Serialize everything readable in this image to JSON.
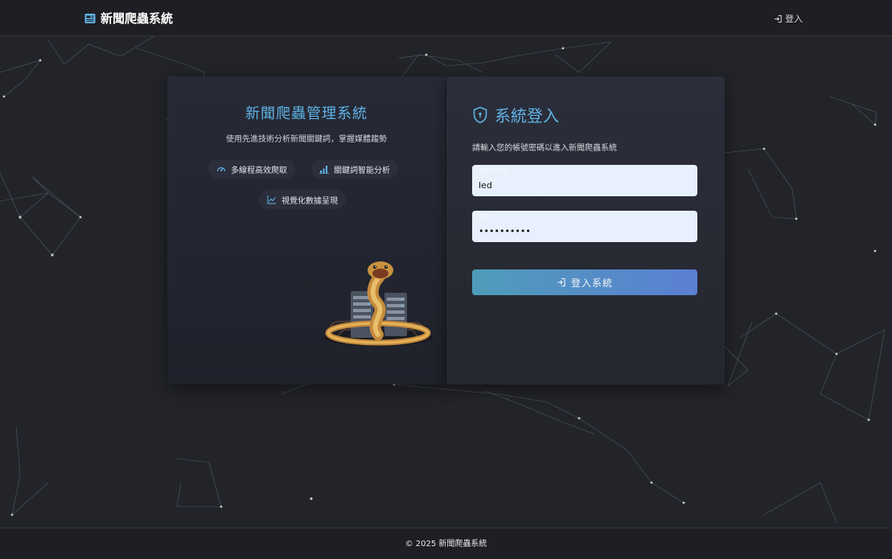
{
  "navbar": {
    "brand": "新聞爬蟲系統",
    "brand_icon": "newspaper-icon",
    "login_label": "登入",
    "login_icon": "sign-in-icon"
  },
  "hero": {
    "title": "新聞爬蟲管理系統",
    "subtitle": "使用先進技術分析新聞關鍵詞，掌握媒體趨勢",
    "features": [
      {
        "label": "多線程高效爬取",
        "icon": "speedometer-icon"
      },
      {
        "label": "關鍵詞智能分析",
        "icon": "bar-chart-icon"
      },
      {
        "label": "視覺化數據呈現",
        "icon": "line-chart-icon"
      }
    ],
    "illustration": "snake-on-servers-illustration"
  },
  "login": {
    "title": "系統登入",
    "title_icon": "shield-icon",
    "description": "請輸入您的帳號密碼以進入新聞爬蟲系統",
    "username_label": "使用者名稱",
    "username_value": "led",
    "password_label": "密碼",
    "password_value": "••••••••••",
    "submit_label": "登入系統",
    "submit_icon": "sign-in-icon"
  },
  "footer": {
    "copyright": "© 2025 新聞爬蟲系統"
  },
  "colors": {
    "accent": "#5fb3e6",
    "button_start": "#4e9db9",
    "button_end": "#5b7fd3",
    "background": "#22242a"
  }
}
